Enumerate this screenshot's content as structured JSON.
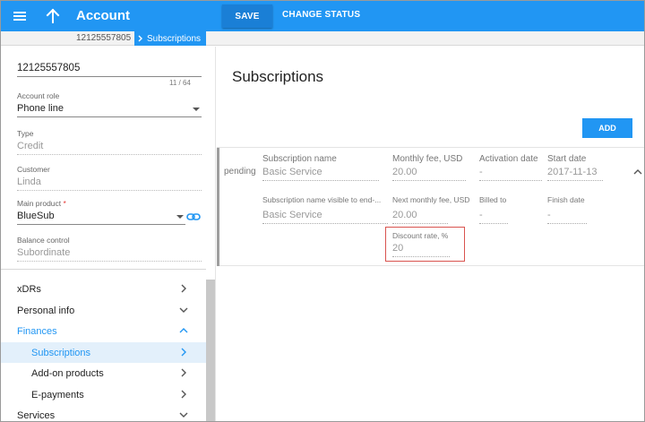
{
  "header": {
    "title": "Account",
    "save_label": "SAVE",
    "change_status_label": "CHANGE STATUS"
  },
  "breadcrumb": {
    "account": "12125557805",
    "current": "Subscriptions"
  },
  "left": {
    "account_id": {
      "value": "12125557805",
      "counter": "11 / 64"
    },
    "account_role": {
      "label": "Account role",
      "value": "Phone line"
    },
    "type": {
      "label": "Type",
      "value": "Credit"
    },
    "customer": {
      "label": "Customer",
      "value": "Linda"
    },
    "main_product": {
      "label": "Main product",
      "required_mark": "*",
      "value": "BlueSub"
    },
    "balance_control": {
      "label": "Balance control",
      "value": "Subordinate"
    }
  },
  "nav": {
    "xdrs": "xDRs",
    "personal_info": "Personal info",
    "finances": "Finances",
    "subscriptions": "Subscriptions",
    "addon_products": "Add-on products",
    "epayments": "E-payments",
    "services": "Services"
  },
  "main": {
    "title": "Subscriptions",
    "add_label": "ADD"
  },
  "subscription": {
    "status": "pending",
    "name": {
      "label": "Subscription name",
      "value": "Basic Service"
    },
    "monthly_fee": {
      "label": "Monthly fee, USD",
      "value": "20.00"
    },
    "activation_date": {
      "label": "Activation date",
      "value": "-"
    },
    "start_date": {
      "label": "Start date",
      "value": "2017-11-13"
    },
    "name_visible": {
      "label": "Subscription name visible to end-...",
      "value": "Basic Service"
    },
    "next_monthly_fee": {
      "label": "Next monthly fee, USD",
      "value": "20.00"
    },
    "billed_to": {
      "label": "Billed to",
      "value": "-"
    },
    "finish_date": {
      "label": "Finish date",
      "value": "-"
    },
    "discount_rate": {
      "label": "Discount rate, %",
      "value": "20"
    }
  },
  "colors": {
    "primary": "#2196f3",
    "highlight_border": "#d9534f",
    "required": "#e53935"
  },
  "icons": [
    "menu-icon",
    "back-arrow-icon",
    "chevron-right-icon",
    "chevron-down-icon",
    "chevron-up-icon",
    "link-icon",
    "dropdown-arrow-icon"
  ]
}
